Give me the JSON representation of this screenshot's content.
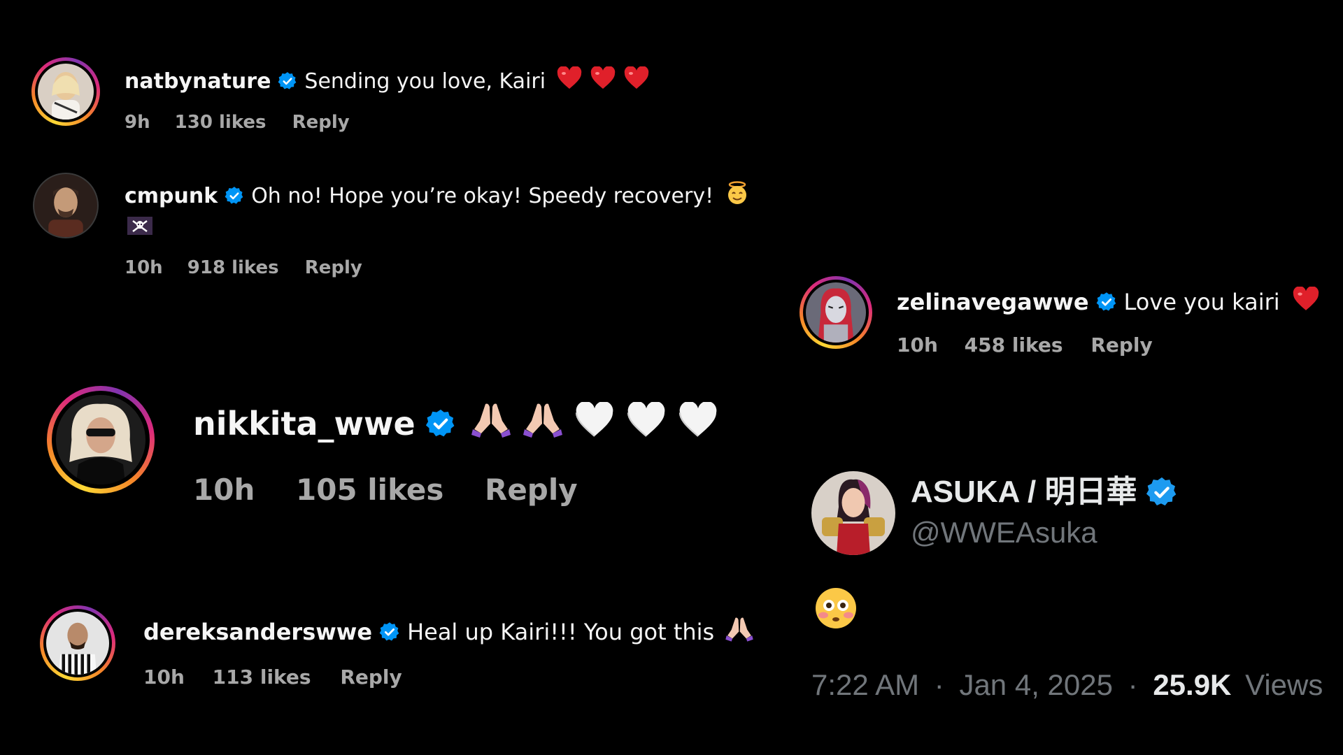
{
  "comments": [
    {
      "username": "natbynature",
      "text": "Sending you love, Kairi",
      "emojis": [
        "red-heart",
        "red-heart",
        "red-heart"
      ],
      "time": "9h",
      "likes": "130 likes",
      "reply_label": "Reply"
    },
    {
      "username": "cmpunk",
      "text": "Oh no! Hope you’re okay! Speedy recovery!",
      "emojis": [
        "face-with-halo",
        "skull-crossbones-flag"
      ],
      "time": "10h",
      "likes": "918 likes",
      "reply_label": "Reply"
    },
    {
      "username": "zelinavegawwe",
      "text": "Love you kairi",
      "emojis": [
        "red-heart"
      ],
      "time": "10h",
      "likes": "458 likes",
      "reply_label": "Reply"
    },
    {
      "username": "nikkita_wwe",
      "text": "",
      "emojis": [
        "folded-hands",
        "folded-hands",
        "white-heart",
        "white-heart",
        "white-heart"
      ],
      "time": "10h",
      "likes": "105 likes",
      "reply_label": "Reply"
    },
    {
      "username": "dereksanderswwe",
      "text": "Heal up Kairi!!! You got this",
      "emojis": [
        "folded-hands"
      ],
      "time": "10h",
      "likes": "113 likes",
      "reply_label": "Reply"
    }
  ],
  "tweet": {
    "display_name": "ASUKA / 明日華",
    "handle": "@WWEAsuka",
    "emoji": "flushed-face",
    "time": "7:22 AM",
    "date": "Jan 4, 2025",
    "views_count": "25.9K",
    "views_label": "Views",
    "separator": "·"
  },
  "colors": {
    "background": "#000000",
    "text": "#f5f5f5",
    "meta": "#a8a8a8",
    "verified": "#0095f6",
    "story_ring": [
      "#fdd835",
      "#f58529",
      "#dd2a7b",
      "#8134af"
    ],
    "tweet_secondary": "#71767b"
  }
}
